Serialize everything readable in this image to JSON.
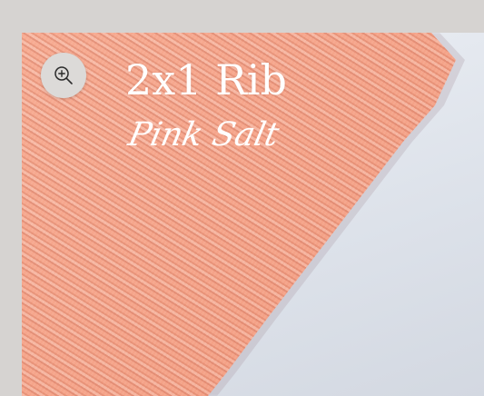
{
  "product": {
    "title": "2x1 Rib",
    "subtitle": "Pink Salt"
  },
  "controls": {
    "zoom_icon": "zoom-in-icon"
  },
  "colors": {
    "page_background": "#d6d3d1",
    "fabric": "#f4a085",
    "backdrop": "#e3e7ee",
    "text": "#ffffff",
    "zoom_button": "#dcdad8"
  }
}
